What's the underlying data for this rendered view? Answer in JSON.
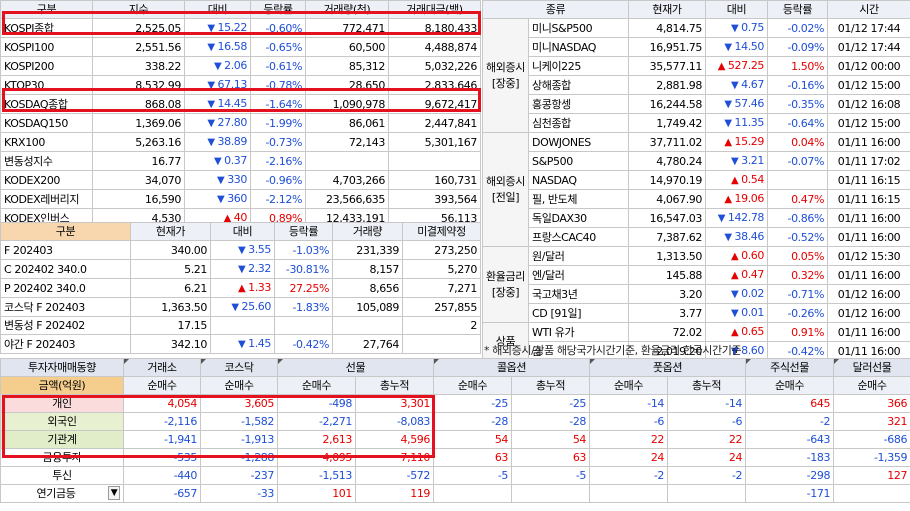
{
  "domestic": {
    "headers": [
      "구분",
      "지수",
      "대비",
      "등락률",
      "거래량(천)",
      "거래대금(백)"
    ],
    "rows": [
      {
        "name": "KOSPI종합",
        "value": "2,525.05",
        "dir": "down",
        "chg": "15.22",
        "rate": "-0.60%",
        "vol": "772,471",
        "amt": "8,180,433"
      },
      {
        "name": "KOSPI100",
        "value": "2,551.56",
        "dir": "down",
        "chg": "16.58",
        "rate": "-0.65%",
        "vol": "60,500",
        "amt": "4,488,874"
      },
      {
        "name": "KOSPI200",
        "value": "338.22",
        "dir": "down",
        "chg": "2.06",
        "rate": "-0.61%",
        "vol": "85,312",
        "amt": "5,032,226"
      },
      {
        "name": "KTOP30",
        "value": "8,532.99",
        "dir": "down",
        "chg": "67.13",
        "rate": "-0.78%",
        "vol": "28,650",
        "amt": "2,833,646"
      },
      {
        "name": "KOSDAQ종합",
        "value": "868.08",
        "dir": "down",
        "chg": "14.45",
        "rate": "-1.64%",
        "vol": "1,090,978",
        "amt": "9,672,417"
      },
      {
        "name": "KOSDAQ150",
        "value": "1,369.06",
        "dir": "down",
        "chg": "27.80",
        "rate": "-1.99%",
        "vol": "86,061",
        "amt": "2,447,841"
      },
      {
        "name": "KRX100",
        "value": "5,263.16",
        "dir": "down",
        "chg": "38.89",
        "rate": "-0.73%",
        "vol": "72,143",
        "amt": "5,301,167"
      },
      {
        "name": "변동성지수",
        "value": "16.77",
        "dir": "down",
        "chg": "0.37",
        "rate": "-2.16%",
        "vol": "",
        "amt": ""
      },
      {
        "name": "KODEX200",
        "value": "34,070",
        "dir": "down",
        "chg": "330",
        "rate": "-0.96%",
        "vol": "4,703,266",
        "amt": "160,731"
      },
      {
        "name": "KODEX레버리지",
        "value": "16,590",
        "dir": "down",
        "chg": "360",
        "rate": "-2.12%",
        "vol": "23,566,635",
        "amt": "393,564"
      },
      {
        "name": "KODEX인버스",
        "value": "4,530",
        "dir": "up",
        "chg": "40",
        "rate": "0.89%",
        "vol": "12,433,191",
        "amt": "56,113"
      }
    ]
  },
  "futures": {
    "headers": [
      "구분",
      "현재가",
      "대비",
      "등락률",
      "거래량",
      "미결제약정"
    ],
    "rows": [
      {
        "name": "F 202403",
        "value": "340.00",
        "dir": "down",
        "chg": "3.55",
        "rate": "-1.03%",
        "vol": "231,339",
        "oi": "273,250"
      },
      {
        "name": "C 202402 340.0",
        "value": "5.21",
        "dir": "down",
        "chg": "2.32",
        "rate": "-30.81%",
        "vol": "8,157",
        "oi": "5,270"
      },
      {
        "name": "P 202402 340.0",
        "value": "6.21",
        "dir": "up",
        "chg": "1.33",
        "rate": "27.25%",
        "vol": "8,656",
        "oi": "7,271"
      },
      {
        "name": "코스닥 F 202403",
        "value": "1,363.50",
        "dir": "down",
        "chg": "25.60",
        "rate": "-1.83%",
        "vol": "105,089",
        "oi": "257,855"
      },
      {
        "name": "변동성 F 202402",
        "value": "17.15",
        "dir": "",
        "chg": "",
        "rate": "",
        "vol": "",
        "oi": "2"
      },
      {
        "name": "야간 F 202403",
        "value": "342.10",
        "dir": "down",
        "chg": "1.45",
        "rate": "-0.42%",
        "vol": "27,764",
        "oi": ""
      }
    ]
  },
  "global": {
    "headers": [
      "종류",
      "",
      "현재가",
      "대비",
      "등락률",
      "시간"
    ],
    "groups": [
      {
        "label": "해외증시[장중]",
        "rows": [
          {
            "name": "미니S&P500",
            "value": "4,814.75",
            "dir": "down",
            "chg": "0.75",
            "rate": "-0.02%",
            "time": "01/12 17:44"
          },
          {
            "name": "미니NASDAQ",
            "value": "16,951.75",
            "dir": "down",
            "chg": "14.50",
            "rate": "-0.09%",
            "time": "01/12 17:44"
          },
          {
            "name": "니케이225",
            "value": "35,577.11",
            "dir": "up",
            "chg": "527.25",
            "rate": "1.50%",
            "time": "01/12 00:00"
          },
          {
            "name": "상해종합",
            "value": "2,881.98",
            "dir": "down",
            "chg": "4.67",
            "rate": "-0.16%",
            "time": "01/12 15:00"
          },
          {
            "name": "홍콩항셍",
            "value": "16,244.58",
            "dir": "down",
            "chg": "57.46",
            "rate": "-0.35%",
            "time": "01/12 16:08"
          },
          {
            "name": "심천종합",
            "value": "1,749.42",
            "dir": "down",
            "chg": "11.35",
            "rate": "-0.64%",
            "time": "01/12 15:00"
          }
        ]
      },
      {
        "label": "해외증시[전일]",
        "rows": [
          {
            "name": "DOWJONES",
            "value": "37,711.02",
            "dir": "up",
            "chg": "15.29",
            "rate": "0.04%",
            "time": "01/11 16:00"
          },
          {
            "name": "S&P500",
            "value": "4,780.24",
            "dir": "down",
            "chg": "3.21",
            "rate": "-0.07%",
            "time": "01/11 17:02"
          },
          {
            "name": "NASDAQ",
            "value": "14,970.19",
            "dir": "up",
            "chg": "0.54",
            "rate": "",
            "time": "01/11 16:15"
          },
          {
            "name": "필, 반도체",
            "value": "4,067.90",
            "dir": "up",
            "chg": "19.06",
            "rate": "0.47%",
            "time": "01/11 16:15"
          },
          {
            "name": "독일DAX30",
            "value": "16,547.03",
            "dir": "down",
            "chg": "142.78",
            "rate": "-0.86%",
            "time": "01/11 16:00"
          },
          {
            "name": "프랑스CAC40",
            "value": "7,387.62",
            "dir": "down",
            "chg": "38.46",
            "rate": "-0.52%",
            "time": "01/11 16:00"
          }
        ]
      },
      {
        "label": "환율금리[장중]",
        "rows": [
          {
            "name": "원/달러",
            "value": "1,313.50",
            "dir": "up",
            "chg": "0.60",
            "rate": "0.05%",
            "time": "01/12 15:30"
          },
          {
            "name": "엔/달러",
            "value": "145.88",
            "dir": "up",
            "chg": "0.47",
            "rate": "0.32%",
            "time": "01/11 16:00"
          },
          {
            "name": "국고채3년",
            "value": "3.20",
            "dir": "down",
            "chg": "0.02",
            "rate": "-0.71%",
            "time": "01/12 16:00"
          },
          {
            "name": "CD [91일]",
            "value": "3.77",
            "dir": "down",
            "chg": "0.01",
            "rate": "-0.26%",
            "time": "01/12 16:00"
          }
        ]
      },
      {
        "label": "상품",
        "rows": [
          {
            "name": "WTI 유가",
            "value": "72.02",
            "dir": "up",
            "chg": "0.65",
            "rate": "0.91%",
            "time": "01/11 16:00"
          },
          {
            "name": "금",
            "value": "2,019.20",
            "dir": "down",
            "chg": "8.60",
            "rate": "-0.42%",
            "time": "01/11 16:00"
          }
        ]
      }
    ],
    "note": "* 해외증시/상품 해당국가시간기준, 환율금리 한국시간기준"
  },
  "investors": {
    "title": "투자자매매동향",
    "amount_label": "금액(억원)",
    "groups": [
      "거래소",
      "코스닥",
      "선물",
      "콜옵션",
      "풋옵션",
      "주식선물",
      "달러선물"
    ],
    "subheaders": [
      "순매수",
      "순매수",
      "순매수",
      "총누적",
      "순매수",
      "총누적",
      "순매수",
      "총누적",
      "순매수",
      "순매수"
    ],
    "rows": [
      {
        "name": "개인",
        "cls": "ind",
        "vals": [
          "4,054",
          "3,605",
          "-498",
          "3,301",
          "-25",
          "-25",
          "-14",
          "-14",
          "645",
          "366"
        ]
      },
      {
        "name": "외국인",
        "cls": "frg",
        "vals": [
          "-2,116",
          "-1,582",
          "-2,271",
          "-8,083",
          "-28",
          "-28",
          "-6",
          "-6",
          "-2",
          "321"
        ]
      },
      {
        "name": "기관계",
        "cls": "ins",
        "vals": [
          "-1,941",
          "-1,913",
          "2,613",
          "4,596",
          "54",
          "54",
          "22",
          "22",
          "-643",
          "-686"
        ]
      },
      {
        "name": "금융투자",
        "cls": "",
        "vals": [
          "-535",
          "-1,288",
          "4,095",
          "7,110",
          "63",
          "63",
          "24",
          "24",
          "-183",
          "-1,359"
        ]
      },
      {
        "name": "투신",
        "cls": "",
        "vals": [
          "-440",
          "-237",
          "-1,513",
          "-572",
          "-5",
          "-5",
          "-2",
          "-2",
          "-298",
          "127"
        ]
      },
      {
        "name": "연기금등",
        "cls": "",
        "vals": [
          "-657",
          "-33",
          "101",
          "119",
          "",
          "",
          "",
          "",
          "-171",
          ""
        ]
      }
    ]
  }
}
